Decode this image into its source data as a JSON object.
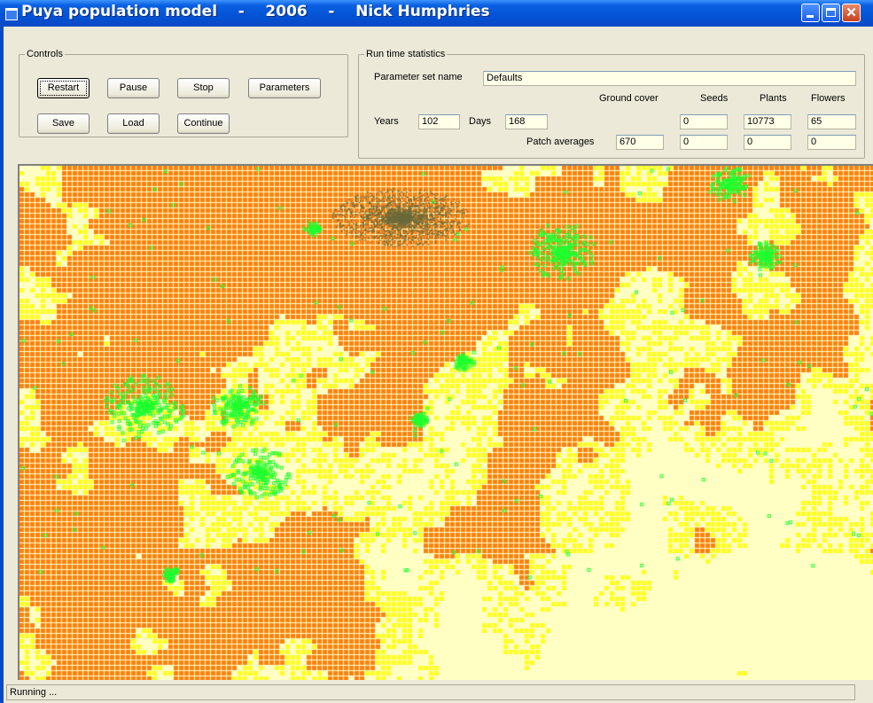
{
  "window": {
    "title": "Puya population model    -    2006    -    Nick Humphries",
    "buttons": {
      "minimize": "minimize-icon",
      "maximize": "maximize-icon",
      "close": "✕"
    }
  },
  "controls": {
    "legend": "Controls",
    "restart": "Restart",
    "pause": "Pause",
    "stop": "Stop",
    "parameters": "Parameters",
    "save": "Save",
    "load": "Load",
    "continue": "Continue"
  },
  "stats": {
    "legend": "Run time statistics",
    "parameter_set_label": "Parameter set name",
    "parameter_set_value": "Defaults",
    "headers": {
      "ground_cover": "Ground cover",
      "seeds": "Seeds",
      "plants": "Plants",
      "flowers": "Flowers"
    },
    "years_label": "Years",
    "years_value": "102",
    "days_label": "Days",
    "days_value": "168",
    "totals": {
      "seeds": "0",
      "plants": "10773",
      "flowers": "65"
    },
    "patch_label": "Patch averages",
    "patch": {
      "ground_cover": "670",
      "seeds": "0",
      "plants": "0",
      "flowers": "0"
    }
  },
  "simulation": {
    "colors": {
      "background": "#ffffc4",
      "ground_cover": "#ff8010",
      "yellow": "#ffff20",
      "plant": "#20ff30",
      "seed": "#6b6b3a",
      "grid": "#ffffff"
    }
  },
  "status": {
    "text": "Running ..."
  }
}
